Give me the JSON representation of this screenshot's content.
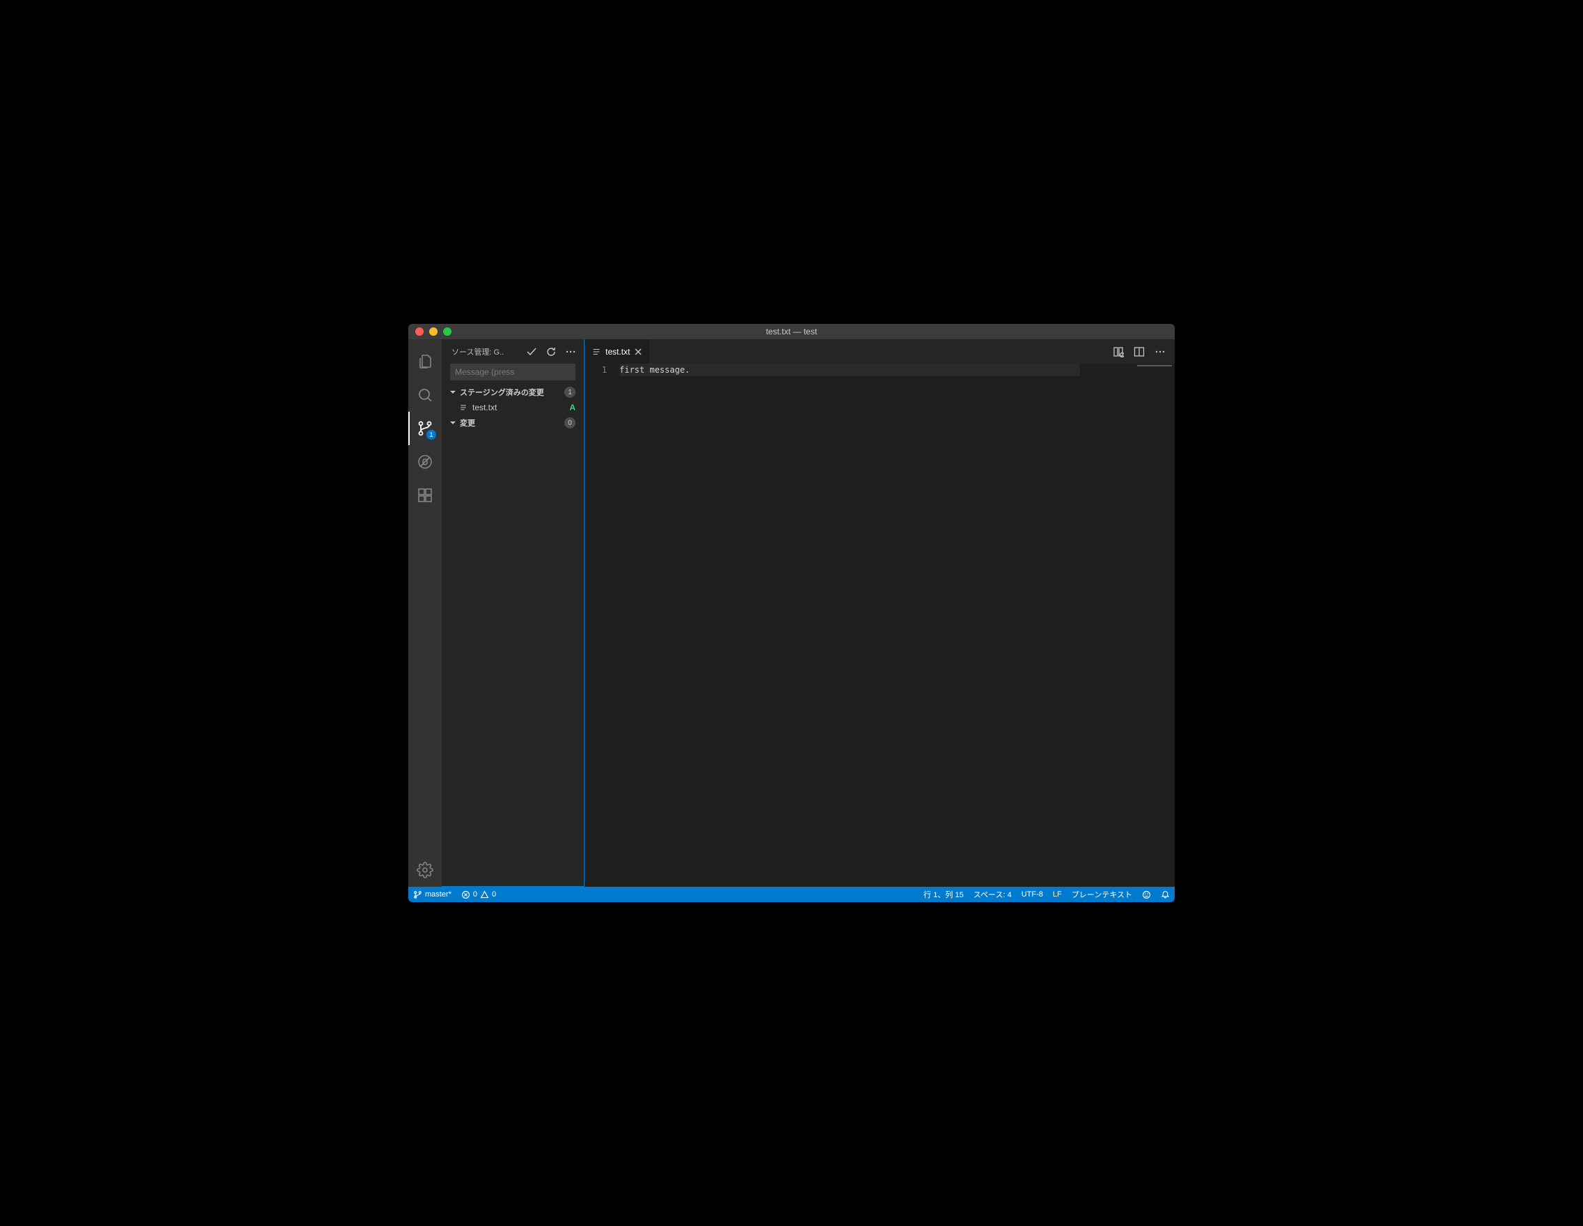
{
  "window": {
    "title": "test.txt — test"
  },
  "activitybar": {
    "scm_badge": "1"
  },
  "sidebar": {
    "title": "ソース管理: G..",
    "commit_placeholder": "Message (press",
    "staged": {
      "label": "ステージング済みの変更",
      "count": "1"
    },
    "staged_file": {
      "name": "test.txt",
      "status": "A"
    },
    "changes": {
      "label": "変更",
      "count": "0"
    }
  },
  "tabs": {
    "file": "test.txt"
  },
  "editor": {
    "line_number": "1",
    "line_content": "first message."
  },
  "statusbar": {
    "branch": "master*",
    "errors": "0",
    "warnings": "0",
    "cursor": "行 1、列 15",
    "spaces": "スペース: 4",
    "encoding": "UTF-8",
    "eol": "LF",
    "lang": "プレーンテキスト"
  }
}
